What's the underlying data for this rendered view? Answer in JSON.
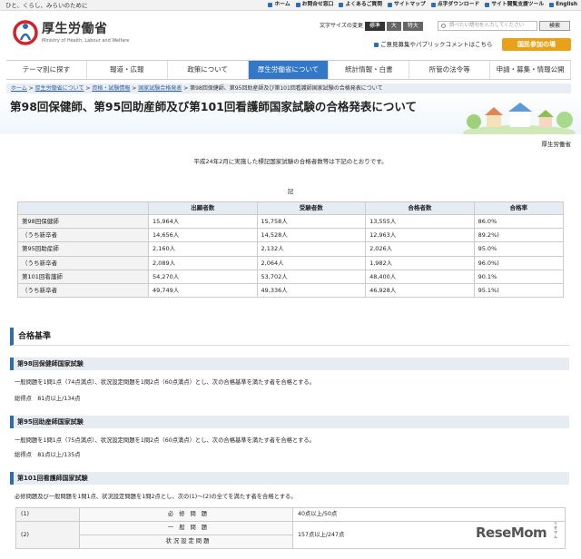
{
  "topbar": {
    "tagline": "ひと、くらし、みらいのために",
    "links": [
      "ホーム",
      "お問合せ窓口",
      "よくあるご質問",
      "サイトマップ",
      "点字ダウンロード",
      "サイト閲覧支援ツール",
      "English"
    ]
  },
  "logo": {
    "jp": "厚生労働省",
    "en": "Ministry of Health, Labour and Welfare"
  },
  "fontsize": {
    "label": "文字サイズの変更",
    "options": [
      "標準",
      "大",
      "特大"
    ]
  },
  "search": {
    "placeholder": "調べたい語句を入力してください",
    "button": "検索"
  },
  "opinion": "ご意見募集やパブリックコメントはこちら",
  "participate": "国民参加の場",
  "nav": [
    "テーマ別に探す",
    "報道・広報",
    "政策について",
    "厚生労働省について",
    "統計情報・白書",
    "所管の法令等",
    "申請・募集・情報公開"
  ],
  "crumb": {
    "links": [
      "ホーム",
      "厚生労働省について",
      "資格・試験情報",
      "国家試験合格発表"
    ],
    "current": "第98回保健師、第95回助産師及び第101回看護師国家試験の合格発表について"
  },
  "title": "第98回保健師、第95回助産師及び第101回看護師国家試験の合格発表について",
  "org": "厚生労働省",
  "intro": "平成24年2月に実施した標記国家試験の合格者数等は下記のとおりです。",
  "ki": "記",
  "results": {
    "headers": [
      "",
      "出願者数",
      "受験者数",
      "合格者数",
      "合格率"
    ],
    "rows": [
      [
        "第98回保健師",
        "15,964人",
        "15,758人",
        "13,555人",
        "86.0%"
      ],
      [
        "（うち新卒者",
        "14,656人",
        "14,528人",
        "12,963人",
        "89.2%)"
      ],
      [
        "第95回助産師",
        "2,160人",
        "2,132人",
        "2,026人",
        "95.0%"
      ],
      [
        "（うち新卒者",
        "2,089人",
        "2,064人",
        "1,982人",
        "96.0%)"
      ],
      [
        "第101回看護師",
        "54,270人",
        "53,702人",
        "48,400人",
        "90.1%"
      ],
      [
        "（うち新卒者",
        "49,749人",
        "49,336人",
        "46,928人",
        "95.1%)"
      ]
    ]
  },
  "criteria": {
    "heading": "合格基準",
    "s1": {
      "title": "第98回保健師国家試験",
      "text": "一般問題を1問1点（74点満点）、状況設定問題を1問2点（60点満点）とし、次の合格基準を満たす者を合格とする。",
      "total": "総得点　81点以上/134点"
    },
    "s2": {
      "title": "第95回助産師国家試験",
      "text": "一般問題を1問1点（75点満点）、状況設定問題を1問2点（60点満点）とし、次の合格基準を満たす者を合格とする。",
      "total": "総得点　81点以上/135点"
    },
    "s3": {
      "title": "第101回看護師国家試験",
      "text": "必修問題及び一般問題を1問1点、状況設定問題を1問2点とし、次の(1)～(2)の全てを満たす者を合格とする。"
    },
    "table": {
      "r1": {
        "no": "(1)",
        "item": "必 修 問 題",
        "val": "40点以上/50点"
      },
      "r2": {
        "no": "(2)",
        "item_a": "一 般 問 題",
        "item_b": "状況設定問題",
        "val": "157点以上/247点"
      }
    }
  },
  "watermark": {
    "text": "ReseMom",
    "small": "リセマム"
  }
}
